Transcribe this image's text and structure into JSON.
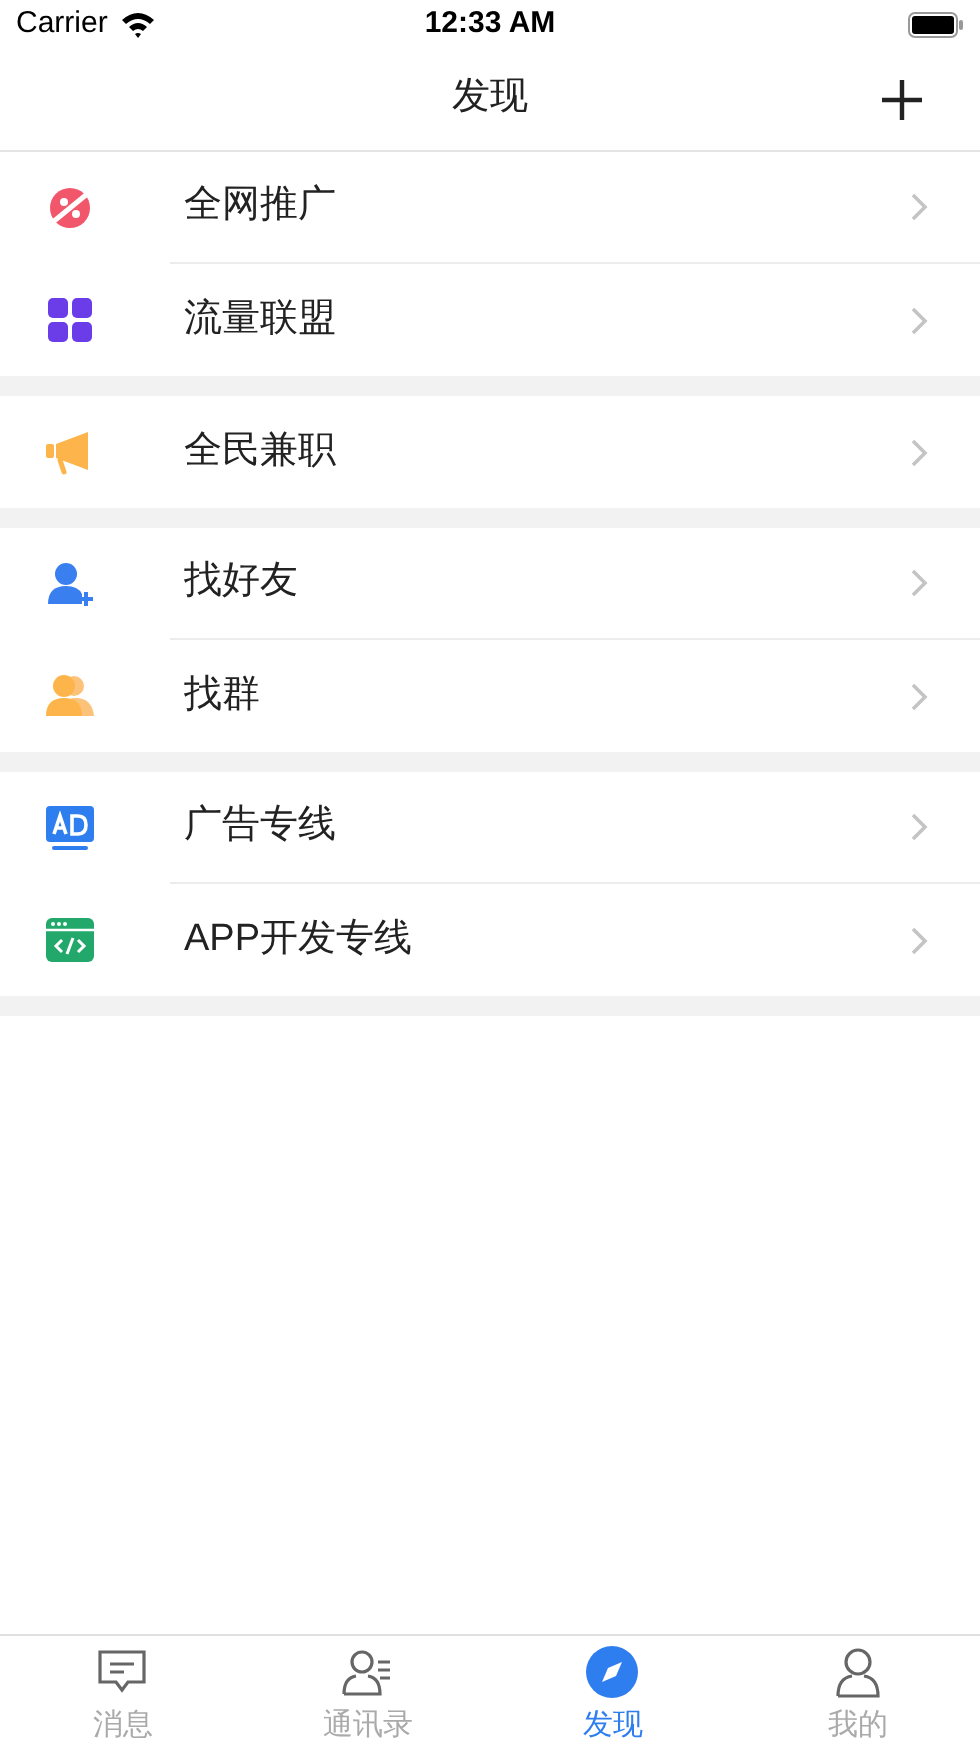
{
  "status_bar": {
    "carrier": "Carrier",
    "time": "12:33 AM"
  },
  "nav": {
    "title": "发现"
  },
  "groups": [
    {
      "items": [
        {
          "kind": "planet",
          "label": "全网推广"
        },
        {
          "kind": "grid",
          "label": "流量联盟"
        }
      ]
    },
    {
      "items": [
        {
          "kind": "megaphone",
          "label": "全民兼职"
        }
      ]
    },
    {
      "items": [
        {
          "kind": "user-add",
          "label": "找好友"
        },
        {
          "kind": "users",
          "label": "找群"
        }
      ]
    },
    {
      "items": [
        {
          "kind": "ad",
          "label": "广告专线"
        },
        {
          "kind": "code",
          "label": "APP开发专线"
        }
      ]
    }
  ],
  "tabs": [
    {
      "kind": "message",
      "label": "消息",
      "selected": false
    },
    {
      "kind": "contacts",
      "label": "通讯录",
      "selected": false
    },
    {
      "kind": "compass",
      "label": "发现",
      "selected": true
    },
    {
      "kind": "profile",
      "label": "我的",
      "selected": false
    }
  ]
}
